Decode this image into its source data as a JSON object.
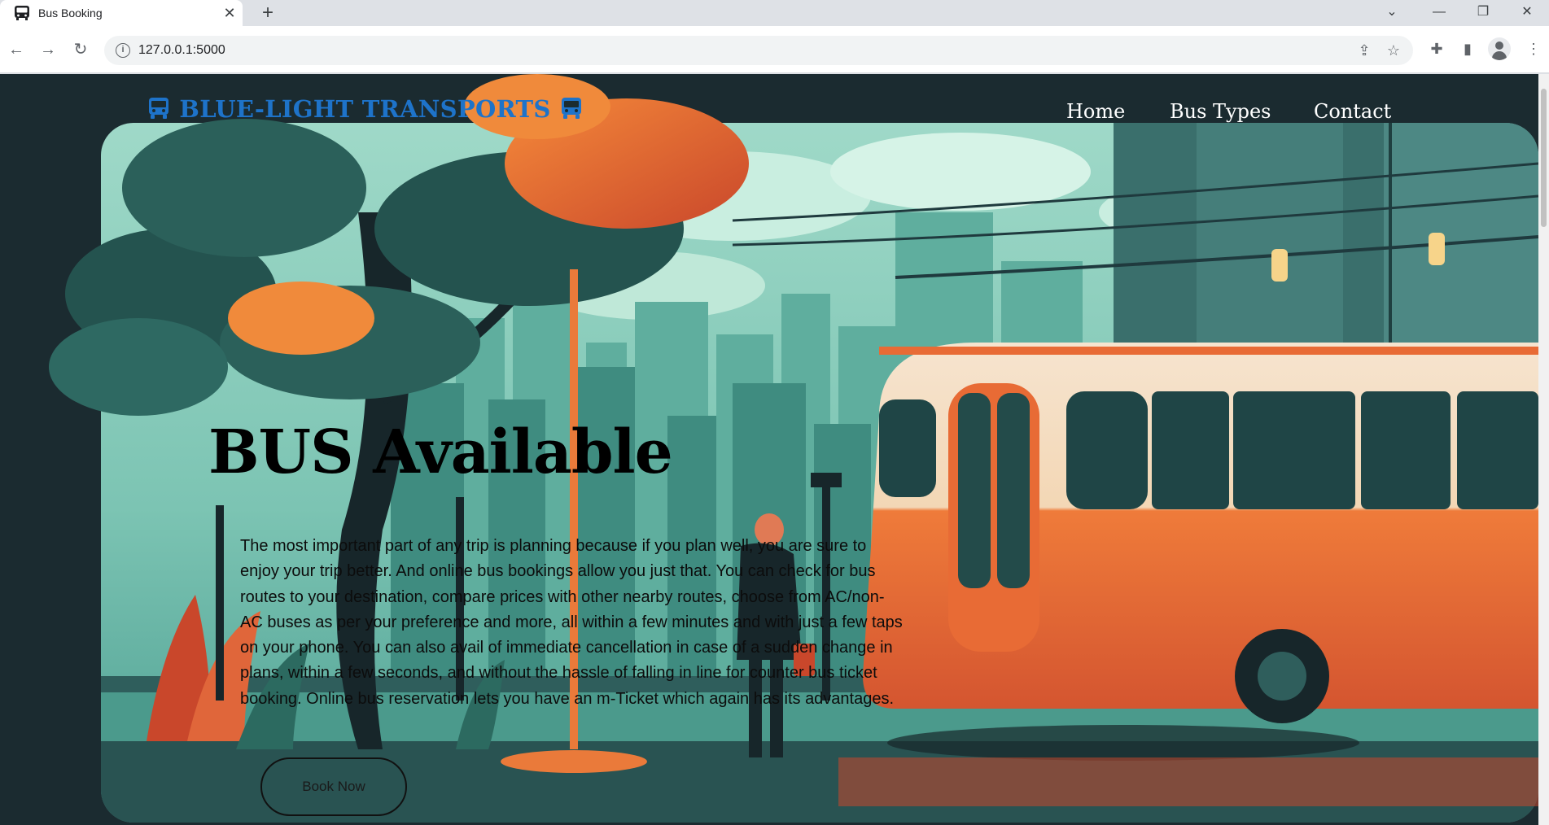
{
  "browser": {
    "tab_title": "Bus Booking",
    "url": "127.0.0.1:5000",
    "icons": [
      "bus-favicon",
      "close-icon",
      "plus-icon",
      "chevron-down-icon",
      "minimize-icon",
      "restore-icon",
      "close-window-icon",
      "back-icon",
      "forward-icon",
      "reload-icon",
      "info-icon",
      "share-icon",
      "star-icon",
      "extensions-icon",
      "side-panel-icon",
      "profile-icon",
      "more-icon"
    ]
  },
  "site": {
    "brand": "BLUE-LIGHT TRANSPORTS",
    "brand_color": "#1e73c9",
    "nav": [
      "Home",
      "Bus Types",
      "Contact"
    ]
  },
  "hero": {
    "title": "BUS Available",
    "body": "The most important part of any trip is planning because if you plan well, you are sure to enjoy your trip better. And online bus bookings allow you just that. You can check for bus routes to your destination, compare prices with other nearby routes, choose from AC/non-AC buses as per your preference and more, all within a few minutes and with just a few taps on your phone. You can also avail of immediate cancellation in case of a sudden change in plans, within a few seconds, and without the hassle of falling in line for counter bus ticket booking. Online bus reservation lets you have an m-Ticket which again has its advantages.",
    "button": "Book Now"
  }
}
